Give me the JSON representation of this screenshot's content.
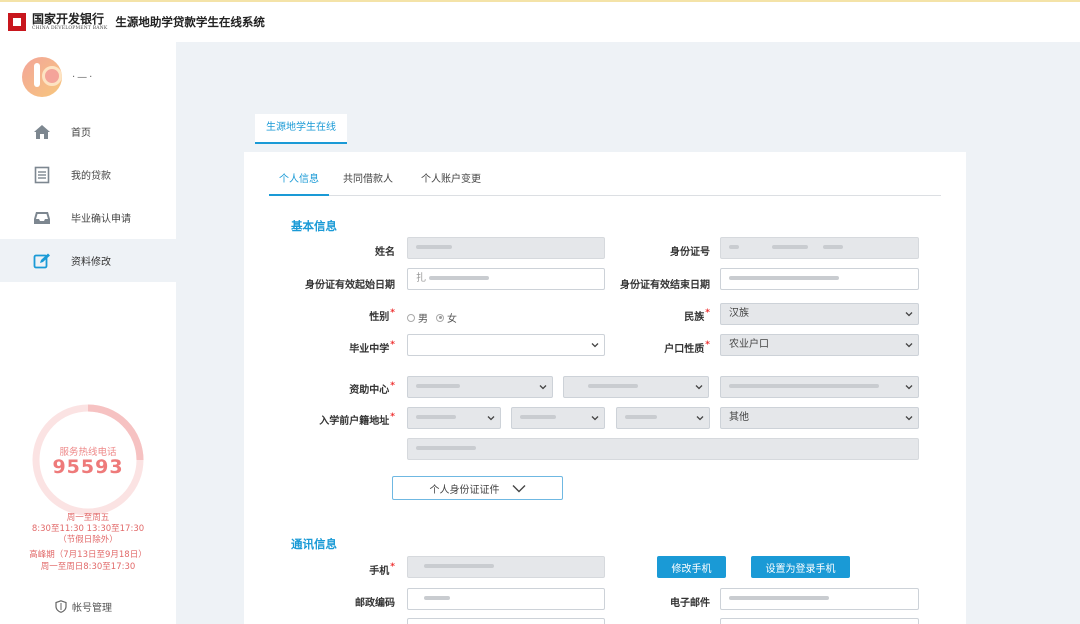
{
  "header": {
    "bank_name_cn": "国家开发银行",
    "bank_name_en": "CHINA DEVELOPMENT BANK",
    "system_title": "生源地助学贷款学生在线系统"
  },
  "sidebar": {
    "username": "·—·",
    "items": [
      {
        "label": "首页",
        "icon": "home-icon"
      },
      {
        "label": "我的贷款",
        "icon": "document-icon"
      },
      {
        "label": "毕业确认申请",
        "icon": "inbox-icon"
      },
      {
        "label": "资料修改",
        "icon": "edit-icon"
      }
    ],
    "active_index": 3,
    "hotline": {
      "label": "服务热线电话",
      "number": "95593",
      "hours_line1": "周一至周五",
      "hours_line2": "8:30至11:30 13:30至17:30",
      "hours_line3": "（节假日除外）",
      "peak_line1": "高峰期（7月13日至9月18日）",
      "peak_line2": "周一至周日8:30至17:30"
    },
    "account_label": "帐号管理"
  },
  "main": {
    "top_tab": "生源地学生在线",
    "subtabs": [
      "个人信息",
      "共同借款人",
      "个人账户变更"
    ],
    "active_subtab": 0,
    "section_basic": "基本信息",
    "section_contact": "通讯信息",
    "labels": {
      "name": "姓名",
      "id_number": "身份证号",
      "id_start": "身份证有效起始日期",
      "id_end": "身份证有效结束日期",
      "gender": "性别",
      "ethnicity": "民族",
      "high_school": "毕业中学",
      "hukou_type": "户口性质",
      "aid_center": "资助中心",
      "address": "入学前户籍地址",
      "phone": "手机",
      "postal_code": "邮政编码",
      "email": "电子邮件"
    },
    "gender_options": [
      "男",
      "女"
    ],
    "gender_selected": "女",
    "ethnicity_value": "汉族",
    "hukou_value": "农业户口",
    "address_last_value": "其他",
    "id_start_value": "扎",
    "expand_button": "个人身份证证件",
    "modify_phone_button": "修改手机",
    "set_login_phone_button": "设置为登录手机"
  },
  "colors": {
    "accent": "#1a9ad6",
    "bank_red": "#c8161d",
    "hotline": "#ee7a7a"
  }
}
